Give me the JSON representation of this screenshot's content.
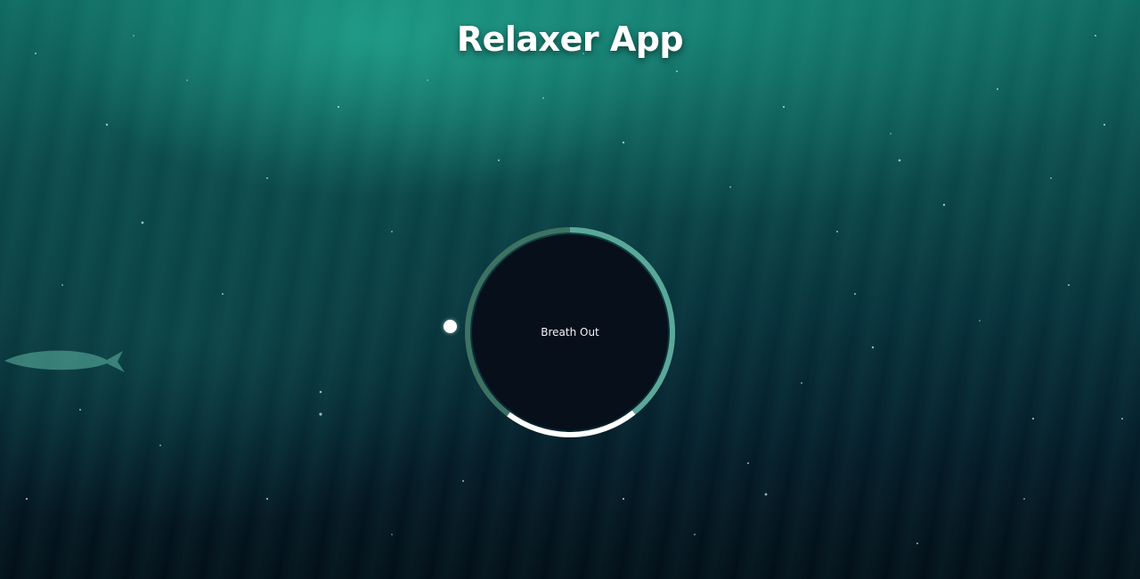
{
  "app": {
    "title": "Relaxer App"
  },
  "breath": {
    "phase_text": "Breath Out"
  },
  "colors": {
    "ring_muted": "#3d7263",
    "ring_accent": "#5ba89a",
    "ring_hold": "#ffffff",
    "core": "#070f1b",
    "pointer": "#ffffff"
  }
}
